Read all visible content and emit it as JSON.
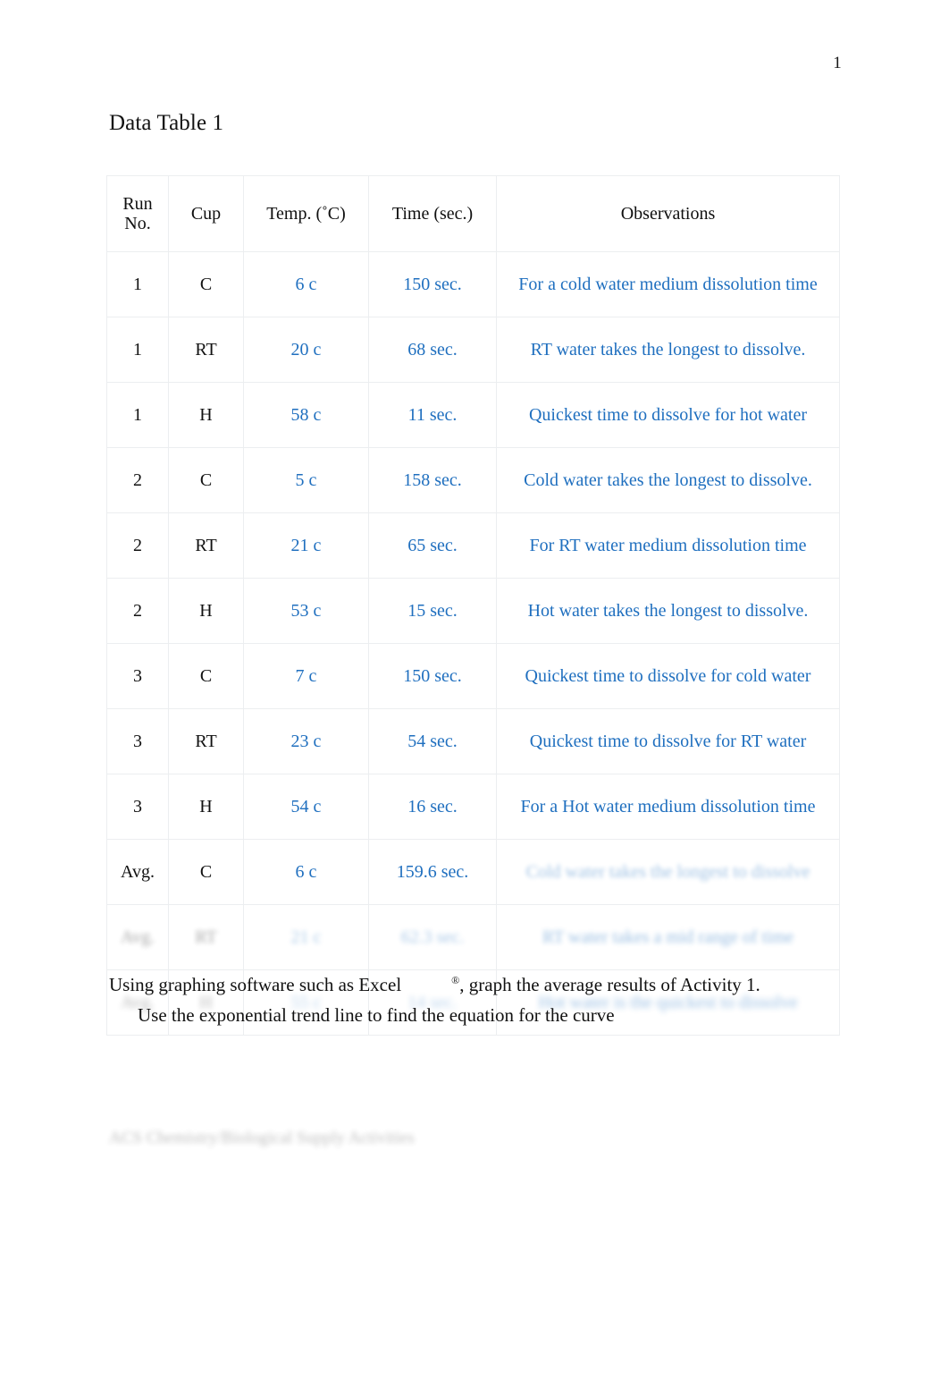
{
  "page": {
    "number": "1"
  },
  "document": {
    "title": "Data Table 1"
  },
  "table": {
    "headers": {
      "run_no_line1": "Run",
      "run_no_line2": "No.",
      "cup": "Cup",
      "temp": "Temp. (˚C)",
      "time": "Time (sec.)",
      "observations": "Observations"
    },
    "rows": [
      {
        "run": "1",
        "cup": "C",
        "temp": "6 c",
        "time": "150 sec.",
        "obs": "For a cold water medium dissolution time",
        "legible": "clear"
      },
      {
        "run": "1",
        "cup": "RT",
        "temp": "20 c",
        "time": "68 sec.",
        "obs": "RT water takes the longest to dissolve.",
        "legible": "clear"
      },
      {
        "run": "1",
        "cup": "H",
        "temp": "58 c",
        "time": "11 sec.",
        "obs": "Quickest time to dissolve for hot water",
        "legible": "clear"
      },
      {
        "run": "2",
        "cup": "C",
        "temp": "5 c",
        "time": "158 sec.",
        "obs": "Cold water takes the longest to dissolve.",
        "legible": "clear"
      },
      {
        "run": "2",
        "cup": "RT",
        "temp": "21 c",
        "time": "65 sec.",
        "obs": "For RT water medium dissolution time",
        "legible": "clear"
      },
      {
        "run": "2",
        "cup": "H",
        "temp": "53 c",
        "time": "15 sec.",
        "obs": "Hot water takes the longest to dissolve.",
        "legible": "clear"
      },
      {
        "run": "3",
        "cup": "C",
        "temp": "7 c",
        "time": "150 sec.",
        "obs": "Quickest time to dissolve for cold water",
        "legible": "clear"
      },
      {
        "run": "3",
        "cup": "RT",
        "temp": "23 c",
        "time": "54 sec.",
        "obs": "Quickest time to dissolve for RT water",
        "legible": "clear"
      },
      {
        "run": "3",
        "cup": "H",
        "temp": "54 c",
        "time": "16 sec.",
        "obs": "For a Hot water medium dissolution time",
        "legible": "clear"
      },
      {
        "run": "Avg.",
        "cup": "C",
        "temp": "6 c",
        "time": "159.6 sec.",
        "obs": "Cold water takes the longest to dissolve",
        "legible": "obs-faded"
      },
      {
        "run": "Avg.",
        "cup": "RT",
        "temp": "21 c",
        "time": "62.3 sec.",
        "obs": "RT water takes a mid range of time",
        "legible": "faded"
      },
      {
        "run": "Avg.",
        "cup": "H",
        "temp": "55 c",
        "time": "14 sec.",
        "obs": "Hot water is the quickest to dissolve",
        "legible": "faded"
      }
    ]
  },
  "paragraph": {
    "line1_before": "Using graphing software such as Excel",
    "registered_mark": "®",
    "line1_after": ", graph the average results of Activity 1.",
    "line2": "Use the exponential trend line to find the equation for the curve"
  },
  "footer": {
    "faint_text": "ACS Chemistry/Biological Supply Activities"
  },
  "colors": {
    "data_blue": "#1f6fbf",
    "text_black": "#111111",
    "table_border": "#eceef0",
    "page_background": "#ffffff"
  }
}
